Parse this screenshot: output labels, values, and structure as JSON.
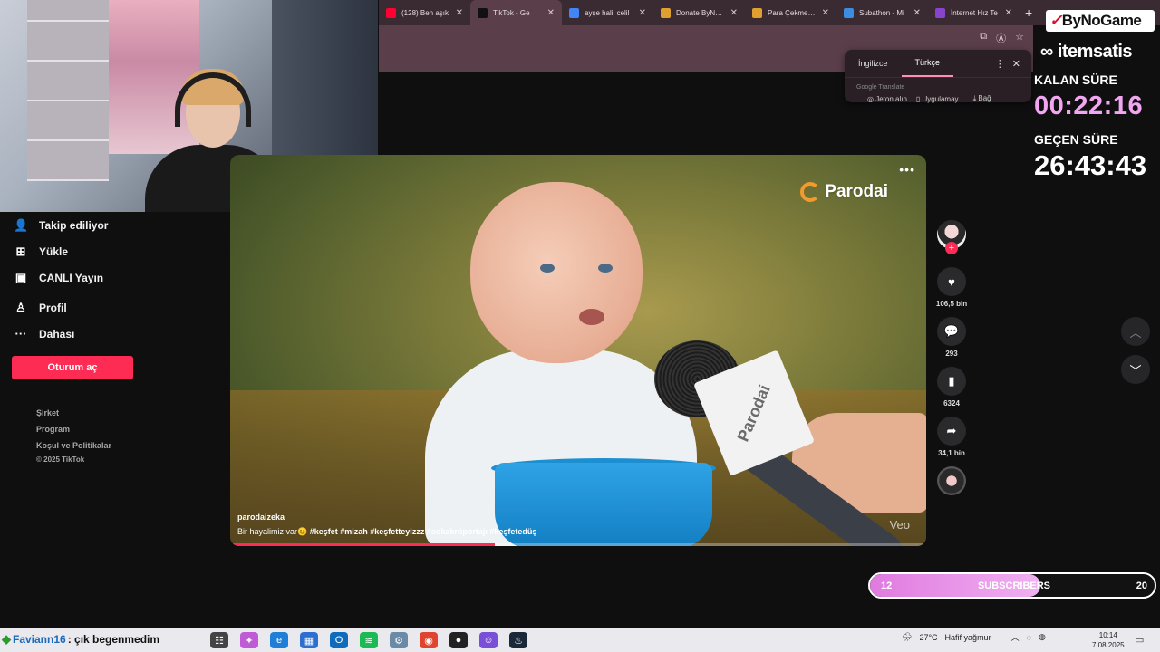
{
  "browser": {
    "tabs": [
      {
        "title": "(128) Ben aşık",
        "favicon_color": "#ff0033",
        "favicon": "youtube-icon"
      },
      {
        "title": "TikTok - Ge",
        "favicon_color": "#111111",
        "favicon": "tiktok-icon",
        "active": true
      },
      {
        "title": "ayşe halil celil",
        "favicon_color": "#4285f4",
        "favicon": "google-icon"
      },
      {
        "title": "Donate ByNoG",
        "favicon_color": "#e0a030",
        "favicon": "bynogame-icon"
      },
      {
        "title": "Para Çekme Yö",
        "favicon_color": "#e0a030",
        "favicon": "bynogame-icon"
      },
      {
        "title": "Subathon - Mi",
        "favicon_color": "#3b8de0",
        "favicon": "globe-icon"
      },
      {
        "title": "İnternet Hız Te",
        "favicon_color": "#8844cc",
        "favicon": "speedtest-icon"
      }
    ],
    "new_tab": "+",
    "close": "✕"
  },
  "translate_popup": {
    "lang_from": "İngilizce",
    "lang_to": "Türkçe",
    "footer": "Google Translate"
  },
  "top_buttons": {
    "coins": "Jeton alın",
    "app": "Uygulamay...",
    "pc": "Bağ"
  },
  "sidebar": {
    "items": [
      {
        "label": "Takip ediliyor",
        "icon": "person-follow-icon"
      },
      {
        "label": "Yükle",
        "icon": "upload-plus-icon"
      },
      {
        "label": "CANLI Yayın",
        "icon": "live-tv-icon"
      },
      {
        "label": "Profil",
        "icon": "profile-icon"
      },
      {
        "label": "Dahası",
        "icon": "more-dots-icon"
      }
    ],
    "login": "Oturum aç",
    "footer": [
      "Şirket",
      "Program",
      "Koşul ve Politikalar"
    ],
    "copyright": "© 2025 TikTok"
  },
  "video": {
    "brand": "Parodai",
    "mic_text": "Parodai",
    "author": "parodaizeka",
    "caption_text": "Bir hayalimiz var😊",
    "hashtags": "#keşfet  #mizah  #keşfetteyizzz  #sokakröportajı  #keşfetedüş",
    "watermark": "Veo",
    "progress": 0.38
  },
  "rail": {
    "likes": "106,5 bin",
    "comments": "293",
    "saves": "6324",
    "shares": "34,1 bin",
    "follow": "+"
  },
  "overlay": {
    "bynogame": "ByNoGame",
    "itemsatis": "itemsatis",
    "kalan_label": "KALAN SÜRE",
    "kalan_time": "00:22:16",
    "gecen_label": "GEÇEN SÜRE",
    "gecen_time": "26:43:43"
  },
  "subscribers": {
    "current": "12",
    "label": "SUBSCRIBERS",
    "goal": "20",
    "progress": 0.6
  },
  "taskbar": {
    "chat_user": "Faviann16",
    "chat_message": ": çık begenmedim",
    "weather_temp": "27°C",
    "weather_text": "Hafif yağmur",
    "time": "10:14",
    "date": "7.08.2025"
  },
  "colors": {
    "accent": "#fe2c55",
    "timer_pink": "#f2a6f2"
  }
}
